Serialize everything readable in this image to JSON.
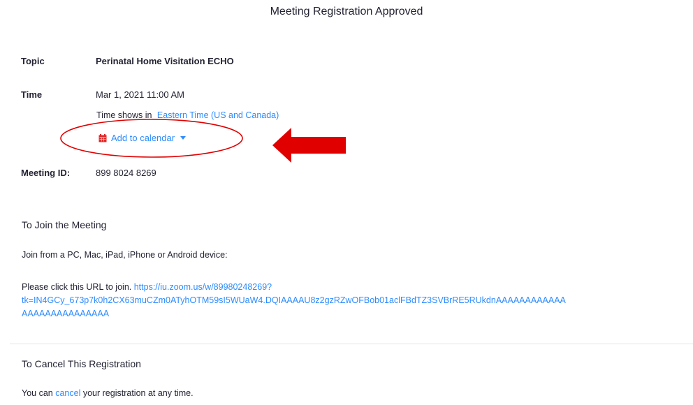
{
  "page": {
    "title": "Meeting Registration Approved"
  },
  "details": {
    "topic_label": "Topic",
    "topic_value": "Perinatal Home Visitation ECHO",
    "time_label": "Time",
    "time_value": "Mar 1, 2021 11:00 AM",
    "timezone_prefix": "Time shows in",
    "timezone_link": "Eastern Time (US and Canada)",
    "calendar_label": "Add to calendar",
    "calendar_icon": "calendar-icon",
    "meeting_id_label": "Meeting ID:",
    "meeting_id_value": "899 8024 8269"
  },
  "join": {
    "heading": "To Join the Meeting",
    "devices_text": "Join from a PC, Mac, iPad, iPhone or Android device:",
    "url_prefix": "Please click this URL to join.",
    "url_part1": "https://iu.zoom.us/w/89980248269?",
    "url_part2": "tk=IN4GCy_673p7k0h2CX63muCZm0ATyhOTM59sI5WUaW4.DQIAAAAU8z2gzRZwOFBob01aclFBdTZ3SVBrRE5RUkdnAAAAAAAAAAAA",
    "url_part3": "AAAAAAAAAAAAAAA"
  },
  "cancel": {
    "heading": "To Cancel This Registration",
    "text_before": "You can",
    "link": "cancel",
    "text_after": "your registration at any time."
  },
  "annotation": {
    "color": "#e00000",
    "arrow_direction": "left",
    "circle_target": "add-to-calendar"
  },
  "colors": {
    "link": "#2d8cff",
    "text": "#232333",
    "calendar_icon": "#e02828",
    "divider": "#e4e4e8"
  }
}
